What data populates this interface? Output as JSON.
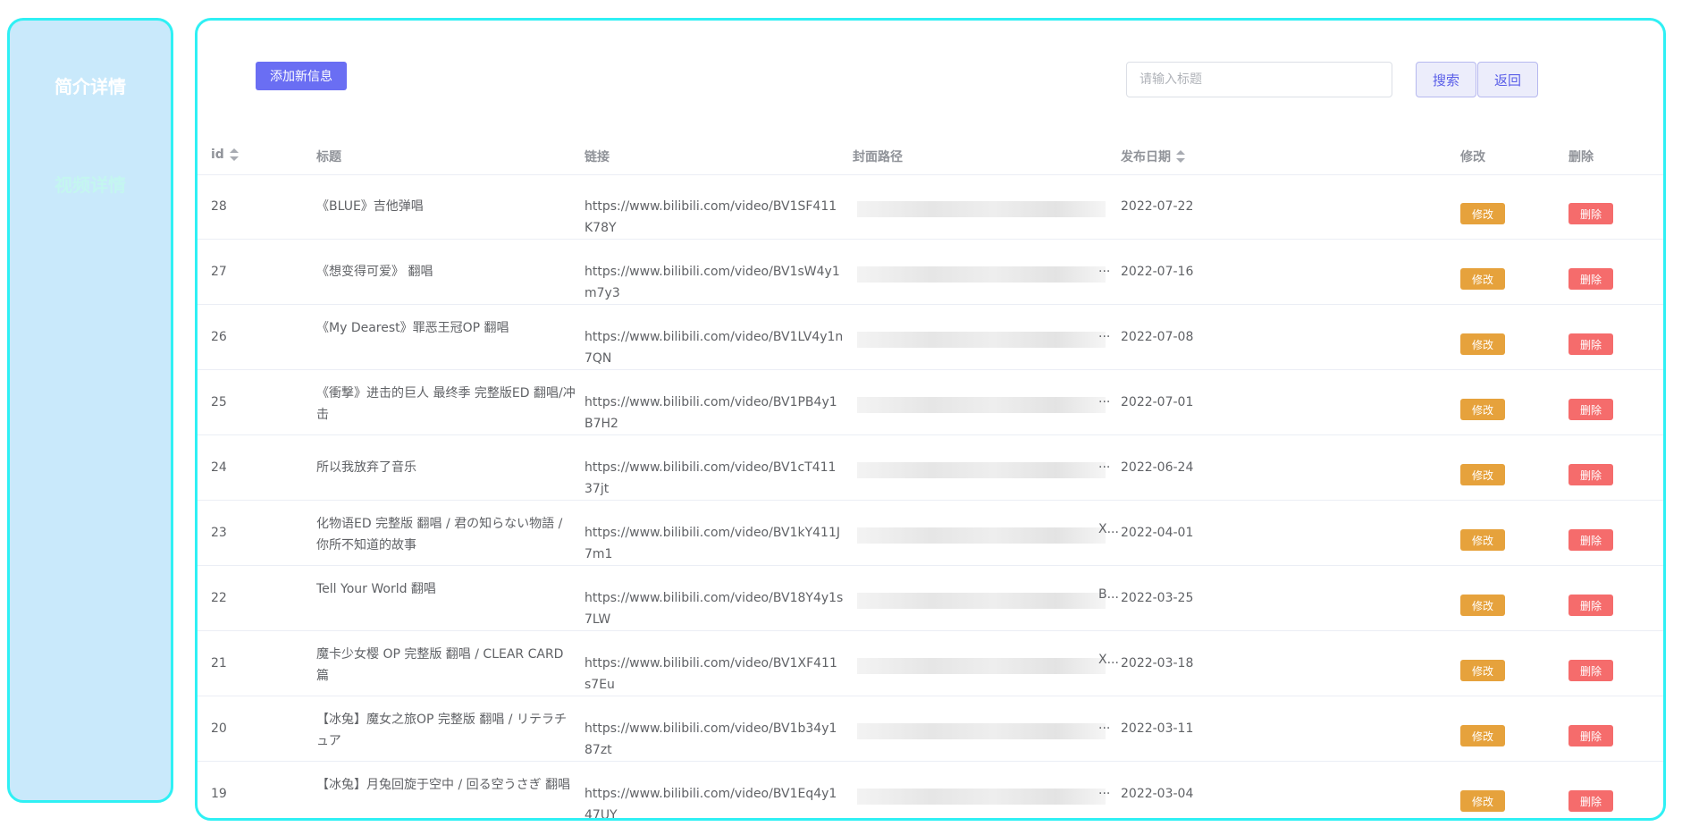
{
  "sidebar": {
    "items": [
      {
        "label": "简介详情"
      },
      {
        "label": "视频详情"
      }
    ]
  },
  "toolbar": {
    "add_label": "添加新信息",
    "search_placeholder": "请输入标题",
    "search_value": "",
    "search_label": "搜索",
    "back_label": "返回"
  },
  "table": {
    "headers": {
      "id": "id",
      "title": "标题",
      "link": "链接",
      "cover": "封面路径",
      "date": "发布日期",
      "edit": "修改",
      "delete": "删除"
    },
    "edit_label": "修改",
    "delete_label": "删除",
    "rows": [
      {
        "id": "28",
        "title": "《BLUE》吉他弹唱",
        "link": "https://www.bilibili.com/video/BV1SF411K78Y",
        "cover_tail": "",
        "date": "2022-07-22"
      },
      {
        "id": "27",
        "title": "《想变得可爱》 翻唱",
        "link": "https://www.bilibili.com/video/BV1sW4y1m7y3",
        "cover_tail": "...",
        "date": "2022-07-16"
      },
      {
        "id": "26",
        "title": "《My Dearest》罪恶王冠OP 翻唱",
        "link": "https://www.bilibili.com/video/BV1LV4y1n7QN",
        "cover_tail": "...",
        "date": "2022-07-08"
      },
      {
        "id": "25",
        "title": "《衝撃》进击的巨人 最终季 完整版ED 翻唱/冲击",
        "link": "https://www.bilibili.com/video/BV1PB4y1B7H2",
        "cover_tail": "...",
        "date": "2022-07-01"
      },
      {
        "id": "24",
        "title": "所以我放弃了音乐",
        "link": "https://www.bilibili.com/video/BV1cT41137jt",
        "cover_tail": "...",
        "date": "2022-06-24"
      },
      {
        "id": "23",
        "title": "化物语ED 完整版 翻唱 / 君の知らない物語 / 你所不知道的故事",
        "link": "https://www.bilibili.com/video/BV1kY411J7m1",
        "cover_tail": "X...",
        "date": "2022-04-01"
      },
      {
        "id": "22",
        "title": "Tell Your World 翻唱",
        "link": "https://www.bilibili.com/video/BV18Y4y1s7LW",
        "cover_tail": "B...",
        "date": "2022-03-25"
      },
      {
        "id": "21",
        "title": "魔卡少女樱 OP 完整版 翻唱 / CLEAR CARD篇",
        "link": "https://www.bilibili.com/video/BV1XF411s7Eu",
        "cover_tail": "X...",
        "date": "2022-03-18"
      },
      {
        "id": "20",
        "title": "【冰兔】魔女之旅OP 完整版 翻唱 / リテラチュア",
        "link": "https://www.bilibili.com/video/BV1b34y187zt",
        "cover_tail": "...",
        "date": "2022-03-11"
      },
      {
        "id": "19",
        "title": "【冰兔】月兔回旋于空中 / 回る空うさぎ 翻唱",
        "link": "https://www.bilibili.com/video/BV1Eq4y147UY",
        "cover_tail": "...",
        "date": "2022-03-04"
      }
    ]
  }
}
